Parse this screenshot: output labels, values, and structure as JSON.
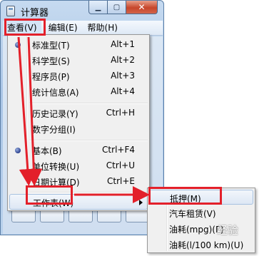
{
  "window": {
    "title": "计算器",
    "minimize_symbol": "▁",
    "maximize_symbol": "▢",
    "close_symbol": "✕"
  },
  "menubar": {
    "view": "查看(V)",
    "edit": "编辑(E)",
    "help": "帮助(H)"
  },
  "view_menu": {
    "items": [
      {
        "label": "标准型(T)",
        "accel": "Alt+1",
        "checked": true
      },
      {
        "label": "科学型(S)",
        "accel": "Alt+2"
      },
      {
        "label": "程序员(P)",
        "accel": "Alt+3"
      },
      {
        "label": "统计信息(A)",
        "accel": "Alt+4"
      },
      {
        "label": "历史记录(Y)",
        "accel": "Ctrl+H"
      },
      {
        "label": "数字分组(I)",
        "accel": ""
      },
      {
        "label": "基本(B)",
        "accel": "Ctrl+F4",
        "checked": true
      },
      {
        "label": "单位转换(U)",
        "accel": "Ctrl+U"
      },
      {
        "label": "日期计算(D)",
        "accel": "Ctrl+E"
      },
      {
        "label": "工作表(W)",
        "accel": "",
        "has_submenu": true
      }
    ]
  },
  "worksheet_submenu": {
    "items": [
      {
        "label": "抵押(M)"
      },
      {
        "label": "汽车租赁(V)"
      },
      {
        "label": "油耗(mpg)(F)"
      },
      {
        "label": "油耗(l/100 km)(U)"
      }
    ]
  },
  "watermark": "经验",
  "colors": {
    "annotation_red": "#e3202a",
    "menu_bg": "#f0f0f0",
    "window_frame": "#b9d1ec"
  }
}
